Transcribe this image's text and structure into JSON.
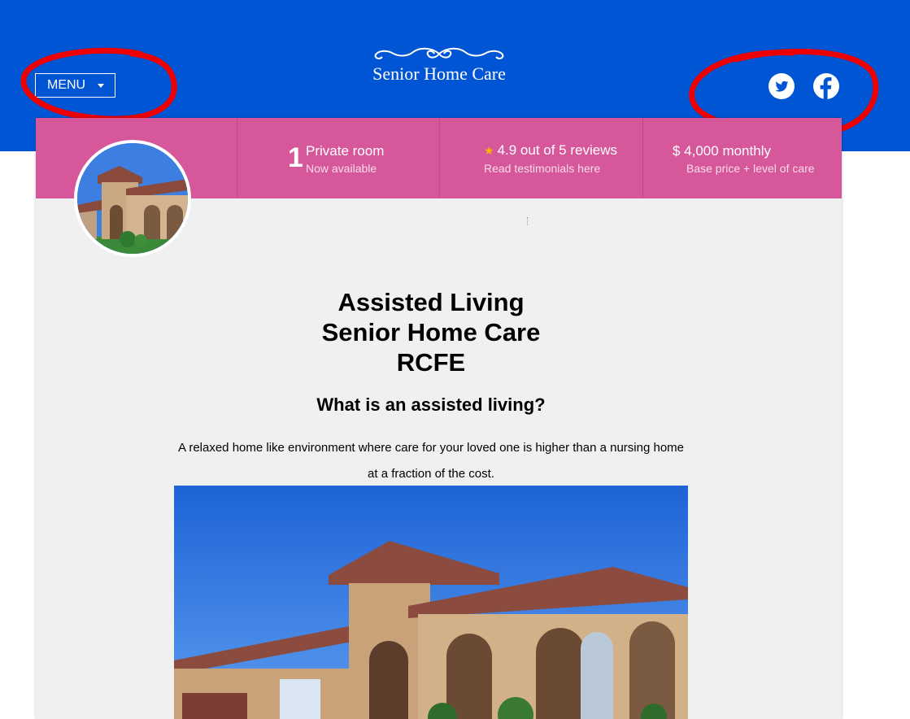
{
  "header": {
    "menu_label": "MENU",
    "logo_text": "Senior Home Care",
    "bg_color": "#0055d4",
    "social": [
      {
        "icon": "twitter-icon"
      },
      {
        "icon": "facebook-icon"
      }
    ]
  },
  "stats": {
    "bg_color": "#d6589b",
    "rooms": {
      "count": "1",
      "title": "Private room",
      "subtitle": "Now available"
    },
    "reviews": {
      "title": "4.9 out of 5 reviews",
      "subtitle": "Read testimonials here",
      "star_color": "#f7b500"
    },
    "price": {
      "title": "$ 4,000 monthly",
      "subtitle": "Base price + level of care"
    }
  },
  "main": {
    "headline_lines": [
      "Assisted Living",
      "Senior Home Care",
      "RCFE"
    ],
    "subheading": "What is an assisted living?",
    "description": "A relaxed home like environment where care for your loved one is higher than a nursing home at a fraction of the cost."
  },
  "annotation_color": "#ee0000"
}
